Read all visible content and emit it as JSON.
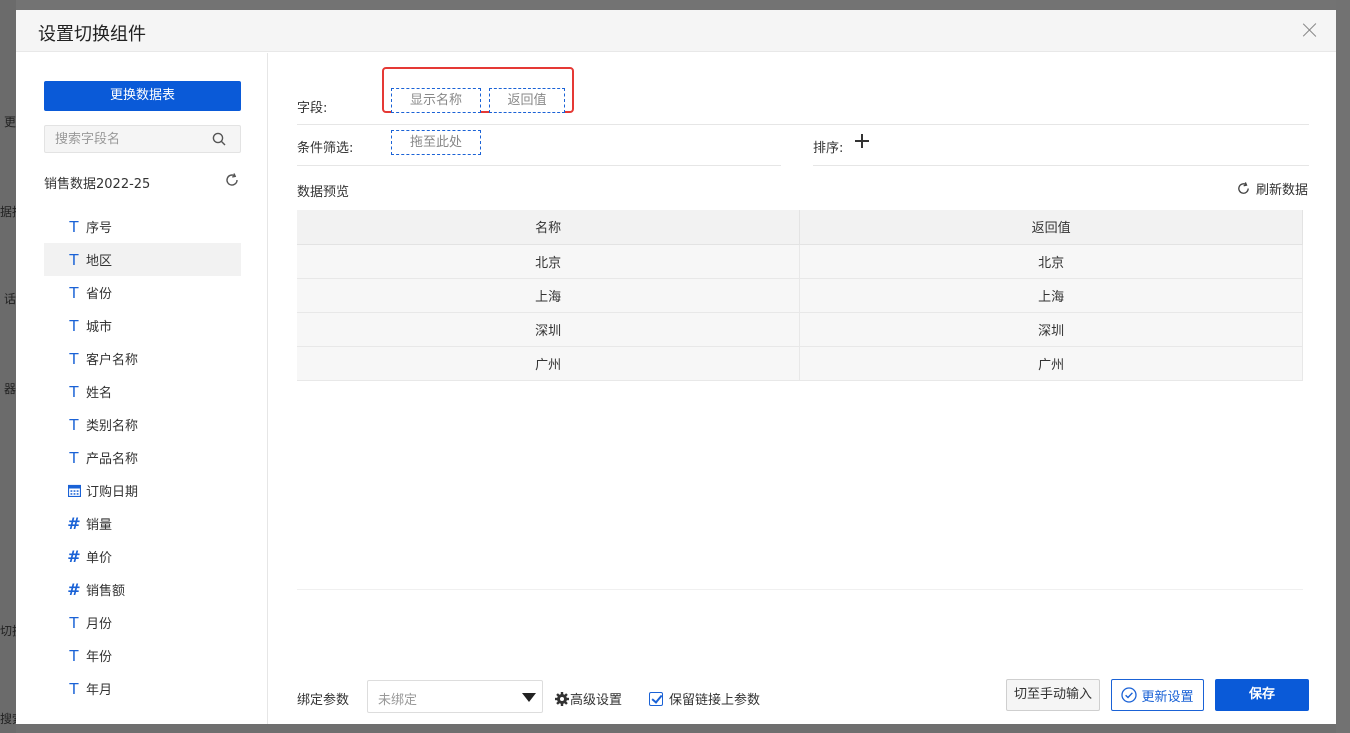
{
  "background": {
    "left_chars": [
      "更",
      "据播",
      "话",
      "器",
      "切换",
      "搜索"
    ]
  },
  "modal": {
    "title": "设置切换组件"
  },
  "sidebar": {
    "change_table_label": "更换数据表",
    "search_placeholder": "搜索字段名",
    "table_name": "销售数据2022-25",
    "fields": [
      {
        "label": "序号",
        "type": "text"
      },
      {
        "label": "地区",
        "type": "text",
        "active": true
      },
      {
        "label": "省份",
        "type": "text"
      },
      {
        "label": "城市",
        "type": "text"
      },
      {
        "label": "客户名称",
        "type": "text"
      },
      {
        "label": "姓名",
        "type": "text"
      },
      {
        "label": "类别名称",
        "type": "text"
      },
      {
        "label": "产品名称",
        "type": "text"
      },
      {
        "label": "订购日期",
        "type": "date"
      },
      {
        "label": "销量",
        "type": "number"
      },
      {
        "label": "单价",
        "type": "number"
      },
      {
        "label": "销售额",
        "type": "number"
      },
      {
        "label": "月份",
        "type": "text"
      },
      {
        "label": "年份",
        "type": "text"
      },
      {
        "label": "年月",
        "type": "text"
      }
    ],
    "icons": {
      "text": "T",
      "number": "#"
    }
  },
  "main": {
    "field_label": "字段:",
    "display_name_chip": "显示名称",
    "return_value_chip": "返回值",
    "filter_label": "条件筛选:",
    "filter_drop": "拖至此处",
    "sort_label": "排序:",
    "preview_label": "数据预览",
    "refresh_label": "刷新数据",
    "table": {
      "headers": [
        "名称",
        "返回值"
      ],
      "rows": [
        [
          "北京",
          "北京"
        ],
        [
          "上海",
          "上海"
        ],
        [
          "深圳",
          "深圳"
        ],
        [
          "广州",
          "广州"
        ]
      ]
    }
  },
  "footer": {
    "bind_label": "绑定参数",
    "bind_value": "未绑定",
    "advanced_label": "高级设置",
    "keep_param_label": "保留链接上参数",
    "keep_param_checked": true,
    "manual_label": "切至手动输入",
    "update_label": "更新设置",
    "save_label": "保存"
  },
  "colors": {
    "primary": "#0a5ad8",
    "highlight": "#e53935"
  }
}
